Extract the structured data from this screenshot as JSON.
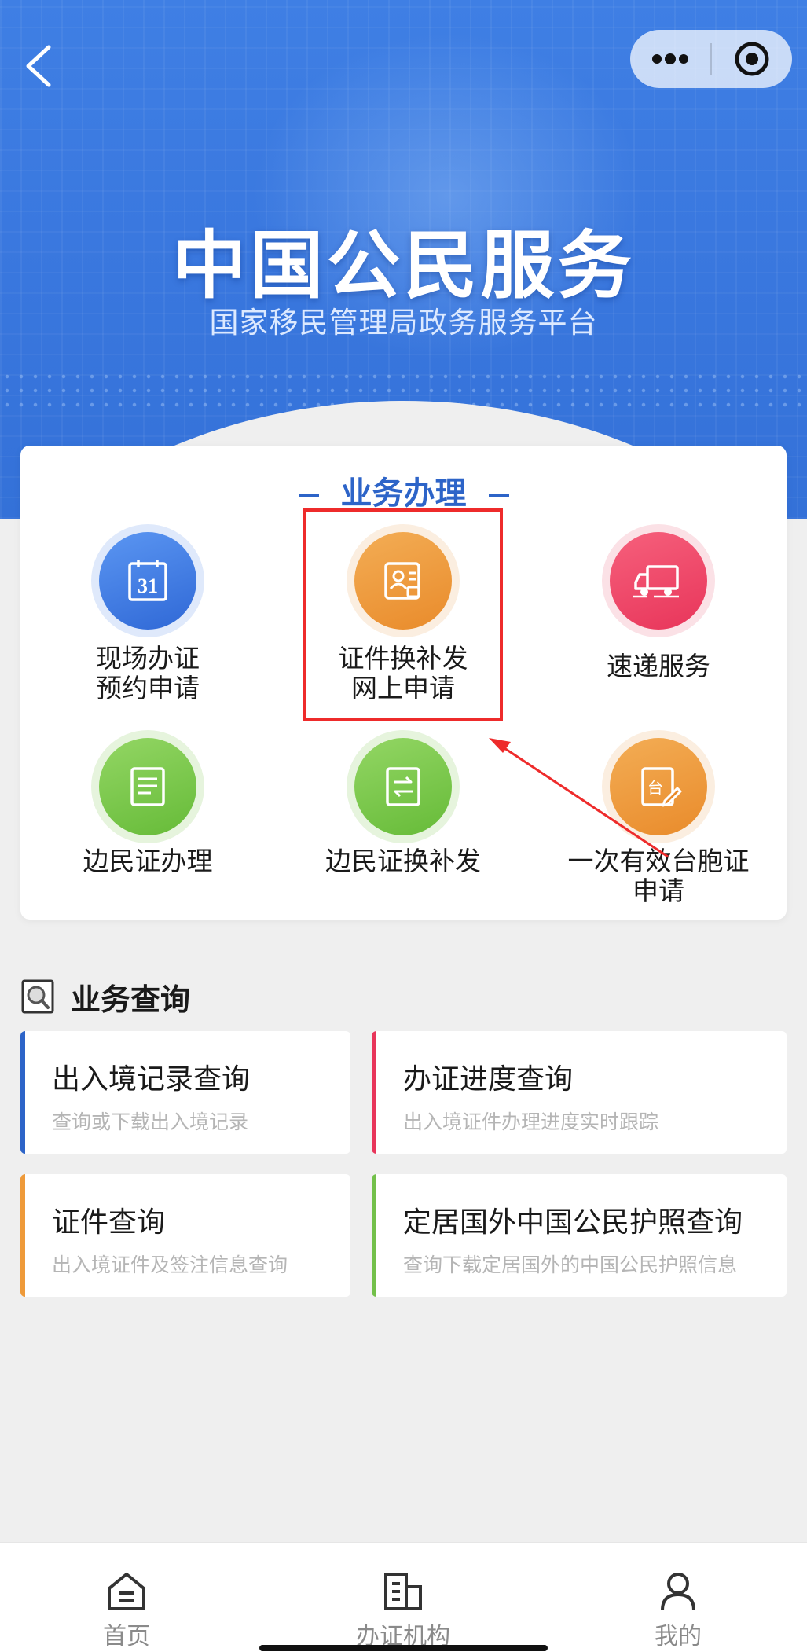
{
  "hero": {
    "title": "中国公民服务",
    "subtitle": "国家移民管理局政务服务平台"
  },
  "business": {
    "header": "业务办理",
    "items": [
      {
        "label_line1": "现场办证",
        "label_line2": "预约申请",
        "icon": "calendar-31-icon",
        "icon_text": "31",
        "color": "blue"
      },
      {
        "label_line1": "证件换补发",
        "label_line2": "网上申请",
        "icon": "id-card-icon",
        "color": "orange"
      },
      {
        "label_line1": "速递服务",
        "label_line2": "",
        "icon": "delivery-truck-icon",
        "color": "red"
      },
      {
        "label_line1": "边民证办理",
        "label_line2": "",
        "icon": "document-icon",
        "color": "green"
      },
      {
        "label_line1": "边民证换补发",
        "label_line2": "",
        "icon": "document-exchange-icon",
        "color": "green"
      },
      {
        "label_line1": "一次有效台胞证",
        "label_line2": "申请",
        "icon": "taiwan-permit-icon",
        "icon_text": "台",
        "color": "orange"
      }
    ]
  },
  "query": {
    "title": "业务查询",
    "cards": [
      {
        "title": "出入境记录查询",
        "subtitle": "查询或下载出入境记录",
        "accent": "#2d64c8"
      },
      {
        "title": "办证进度查询",
        "subtitle": "出入境证件办理进度实时跟踪",
        "accent": "#e8355a"
      },
      {
        "title": "证件查询",
        "subtitle": "出入境证件及签注信息查询",
        "accent": "#ee9a3a"
      },
      {
        "title": "定居国外中国公民护照查询",
        "subtitle": "查询下载定居国外的中国公民护照信息",
        "accent": "#73c04a"
      }
    ]
  },
  "tabbar": {
    "tabs": [
      {
        "label": "首页",
        "icon": "home-icon"
      },
      {
        "label": "办证机构",
        "icon": "building-icon"
      },
      {
        "label": "我的",
        "icon": "user-icon"
      }
    ]
  },
  "colors": {
    "hero_blue": "#3a78df",
    "brand_blue": "#2d64c8",
    "highlight_red": "#ee2b2b"
  }
}
